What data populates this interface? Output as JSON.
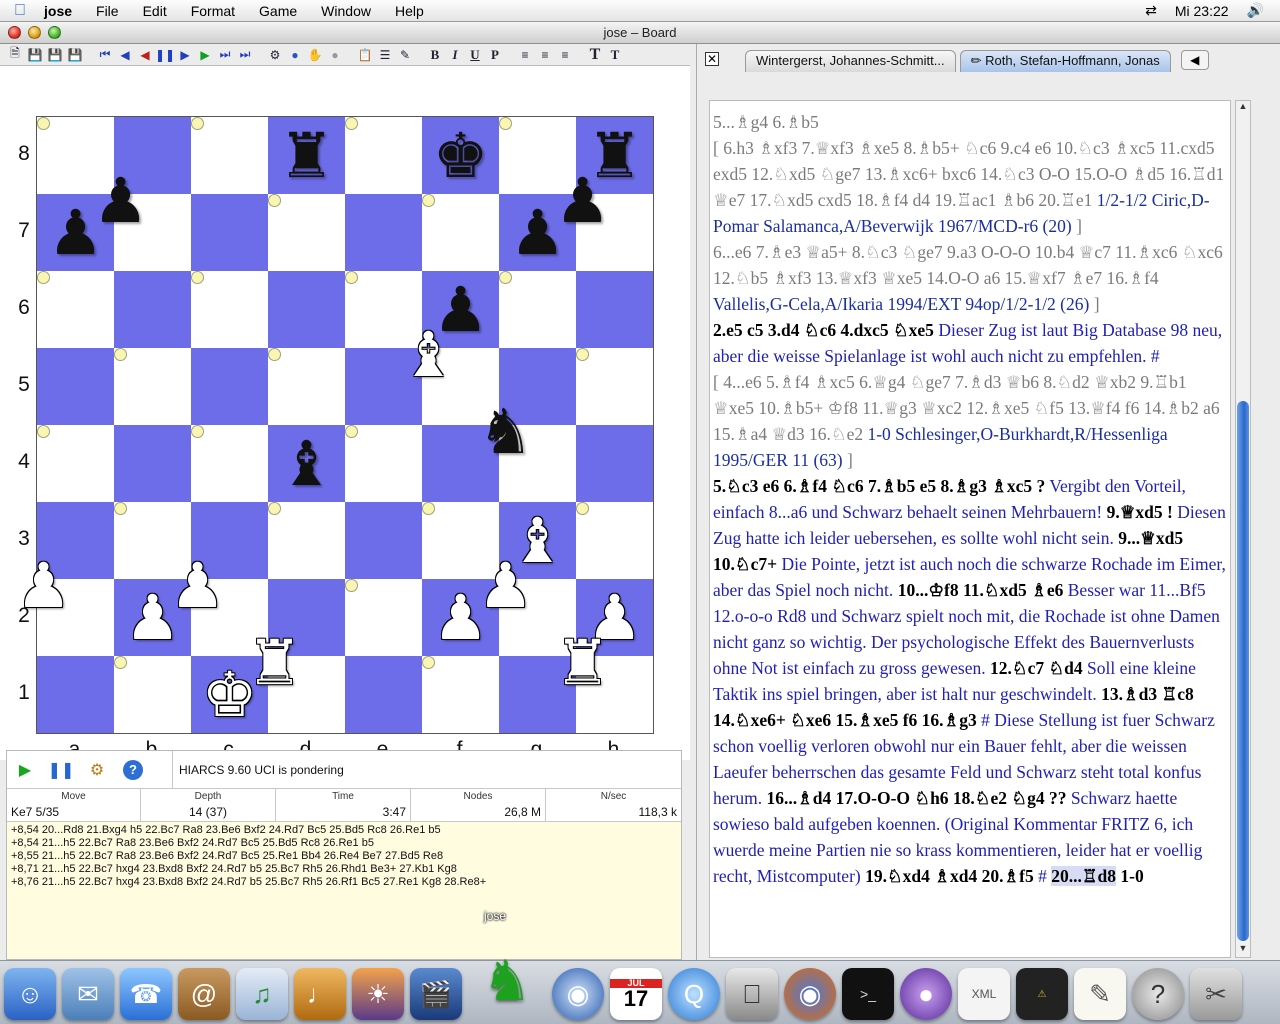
{
  "menubar": {
    "app_name": "jose",
    "menus": [
      "File",
      "Edit",
      "Format",
      "Game",
      "Window",
      "Help"
    ],
    "clock": "Mi 23:22"
  },
  "window": {
    "title": "jose – Board"
  },
  "board": {
    "ranks": [
      "8",
      "7",
      "6",
      "5",
      "4",
      "3",
      "2",
      "1"
    ],
    "files": [
      "a",
      "b",
      "c",
      "d",
      "e",
      "f",
      "g",
      "h"
    ],
    "rows": [
      [
        "",
        "",
        "",
        "r",
        "",
        "k",
        "",
        "r"
      ],
      [
        "p",
        "p",
        "",
        "",
        "",
        "",
        "p",
        "p"
      ],
      [
        "",
        "",
        "",
        "",
        "",
        "p",
        "",
        ""
      ],
      [
        "",
        "",
        "",
        "",
        "",
        "B",
        "",
        ""
      ],
      [
        "",
        "",
        "",
        "b",
        "",
        "",
        "n",
        ""
      ],
      [
        "",
        "",
        "",
        "",
        "",
        "",
        "B",
        ""
      ],
      [
        "P",
        "P",
        "P",
        "",
        "",
        "P",
        "P",
        "P"
      ],
      [
        "",
        "",
        "K",
        "R",
        "",
        "",
        "",
        "R"
      ]
    ],
    "colors": {
      "light": "#f9f6b4",
      "dark": "#6d6de9"
    }
  },
  "engine": {
    "status": "HIARCS 9.60 UCI  is pondering",
    "headers": {
      "move": "Move",
      "depth": "Depth",
      "time": "Time",
      "nodes": "Nodes",
      "nps": "N/sec"
    },
    "values": {
      "move": "Ke7 5/35",
      "depth": "14 (37)",
      "time": "3:47",
      "nodes": "26,8 M",
      "nps": "118,3 k"
    },
    "lines": [
      "+8,54 20...Rd8 21.Bxg4 h5 22.Bc7 Ra8 23.Be6 Bxf2 24.Rd7 Bc5 25.Bd5 Rc8 26.Re1 b5",
      "+8,54 21...h5 22.Bc7 Ra8 23.Be6 Bxf2 24.Rd7 Bc5 25.Bd5 Rc8 26.Re1 b5",
      "+8,55 21...h5 22.Bc7 Ra8 23.Be6 Bxf2 24.Rd7 Bc5 25.Re1 Bb4 26.Re4 Be7 27.Bd5 Re8",
      "+8,71 21...h5 22.Bc7 hxg4 23.Bxd8 Bxf2 24.Rd7 b5 25.Bc7 Rh5 26.Rhd1 Be3+ 27.Kb1 Kg8",
      "+8,76 21...h5 22.Bc7 hxg4 23.Bxd8 Bxf2 24.Rd7 b5 25.Bc7 Rh5 26.Rf1 Bc5 27.Re1 Kg8 28.Re8+"
    ]
  },
  "tabs": [
    {
      "label": "Wintergerst, Johannes-Schmitt..."
    },
    {
      "label": "Roth, Stefan-Hoffmann, Jonas"
    }
  ],
  "notation": {
    "p1": "5...♗g4 6.♗b5",
    "p2": "[ 6.h3 ♗xf3 7.♕xf3 ♗xe5 8.♗b5+ ♘c6 9.c4 e6 10.♘c3 ♗xc5 11.cxd5 exd5 12.♘xd5 ♘ge7 13.♗xc6+ bxc6 14.♘c3 O-O 15.O-O ♗d5 16.♖d1 ♕e7 17.♘xd5 cxd5 18.♗f4 d4 19.♖ac1 ♗b6 20.♖e1",
    "p2_ref": "1/2-1/2 Ciric,D-Pomar Salamanca,A/Beverwijk 1967/MCD-r6 (20)",
    "p2_end": "]",
    "p3": "6...e6 7.♗e3 ♕a5+ 8.♘c3 ♘ge7 9.a3 O-O-O 10.b4 ♕c7 11.♗xc6 ♘xc6 12.♘b5 ♗xf3 13.♕xf3 ♕xe5 14.O-O a6 15.♕xf7 ♗e7 16.♗f4",
    "p3_ref": "Vallelis,G-Cela,A/Ikaria 1994/EXT 94op/1/2-1/2 (26)",
    "p3_end": "]",
    "m1": "2.e5 c5 3.d4 ♘c6 4.dxc5 ♘xe5",
    "c1": "Dieser Zug ist laut Big Database 98 neu, aber die weisse Spielanlage ist wohl auch nicht zu empfehlen. #",
    "p4": "[ 4...e6 5.♗f4 ♗xc5 6.♕g4 ♘ge7 7.♗d3 ♕b6 8.♘d2 ♕xb2 9.♖b1 ♕xe5 10.♗b5+ ♔f8 11.♕g3 ♕xc2 12.♗xe5 ♘f5 13.♕f4 f6 14.♗b2 a6 15.♗a4 ♕d3 16.♘e2",
    "p4_ref": "1-0 Schlesinger,O-Burkhardt,R/Hessenliga 1995/GER 11 (63)",
    "p4_end": "]",
    "m2": "5.♘c3 e6 6.♗f4 ♘c6 7.♗b5 e5 8.♗g3 ♗xc5 ?",
    "c2": "Vergibt den Vorteil, einfach 8...a6 und Schwarz behaelt seinen Mehrbauern!",
    "m3": "9.♕xd5 !",
    "c3": "Diesen Zug hatte ich leider uebersehen, es sollte wohl nicht sein.",
    "m4": "9...♕xd5 10.♘c7+",
    "c4": "Die Pointe, jetzt ist auch noch die schwarze Rochade im Eimer, aber das Spiel noch nicht.",
    "m5": "10...♔f8 11.♘xd5 ♗e6",
    "c5": "Besser war 11...Bf5 12.o-o-o Rd8 und Schwarz spielt noch mit, die Rochade ist ohne Damen nicht ganz so wichtig. Der psychologische Effekt des Bauernverlusts ohne Not ist einfach zu gross gewesen.",
    "m6": "12.♘c7  ♘d4",
    "c6": "Soll eine kleine Taktik ins spiel bringen, aber ist halt nur geschwindelt.",
    "m7": "13.♗d3 ♖c8 14.♘xe6+ ♘xe6 15.♗xe5 f6 16.♗g3",
    "c7": "# Diese Stellung ist fuer Schwarz schon voellig verloren obwohl nur ein Bauer fehlt, aber die weissen Laeufer beherrschen das gesamte Feld und Schwarz steht total konfus herum.",
    "m8": "16...♗d4 17.O-O-O ♘h6 18.♘e2 ♘g4 ??",
    "c8": "Schwarz haette sowieso bald aufgeben koennen. (Original Kommentar FRITZ 6, ich wuerde meine Partien nie so krass kommentieren, leider hat er voellig recht, Mistcomputer)",
    "m9": "19.♘xd4 ♗xd4 20.♗f5",
    "c9": "#",
    "m10": "20...♖d8",
    "m11": "1-0"
  },
  "dock": {
    "active_label": "jose",
    "calendar_month": "JUL",
    "calendar_day": "17"
  }
}
